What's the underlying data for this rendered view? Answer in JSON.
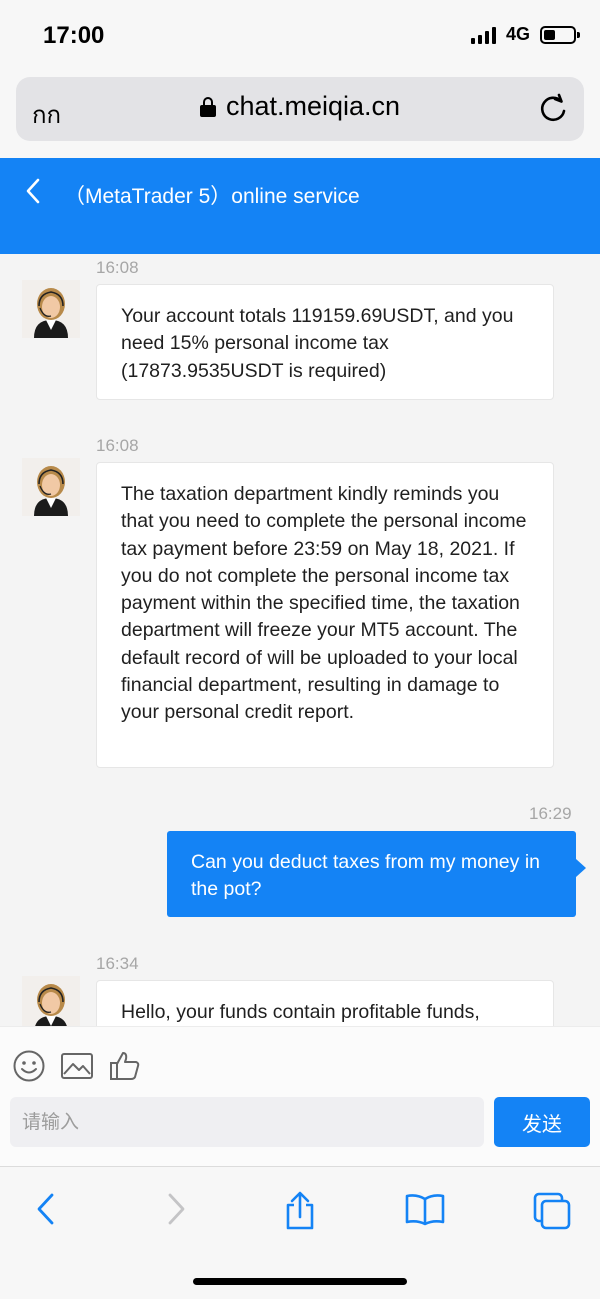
{
  "status_bar": {
    "time": "17:00",
    "network": "4G"
  },
  "browser": {
    "aa_label": "กก",
    "url": "chat.meiqia.cn"
  },
  "chat_header": {
    "title": "（MetaTrader 5）online service"
  },
  "messages": [
    {
      "direction": "incoming",
      "time": "16:08",
      "text": "Your account totals 119159.69USDT, and you need 15% personal income tax (17873.9535USDT is required)"
    },
    {
      "direction": "incoming",
      "time": "16:08",
      "text": "The taxation department kindly reminds you that you need to complete the personal income tax payment before 23:59 on May 18, 2021. If you do not complete the personal income tax payment within the specified time, the taxation department will freeze your MT5 account. The default record of will be uploaded to your local financial department, resulting in damage to your personal credit report."
    },
    {
      "direction": "outgoing",
      "time": "16:29",
      "text": "Can you deduct taxes from my money in the pot?"
    },
    {
      "direction": "incoming",
      "time": "16:34",
      "text": "Hello, your funds contain profitable funds,"
    }
  ],
  "composer": {
    "placeholder": "请输入",
    "send_label": "发送"
  },
  "colors": {
    "accent": "#1483f5",
    "bubble_in": "#ffffff",
    "background": "#f4f4f4"
  },
  "icons": [
    "emoji-icon",
    "image-icon",
    "thumbs-up-icon",
    "back-icon",
    "forward-icon",
    "share-icon",
    "bookmarks-icon",
    "tabs-icon",
    "reload-icon",
    "lock-icon"
  ]
}
